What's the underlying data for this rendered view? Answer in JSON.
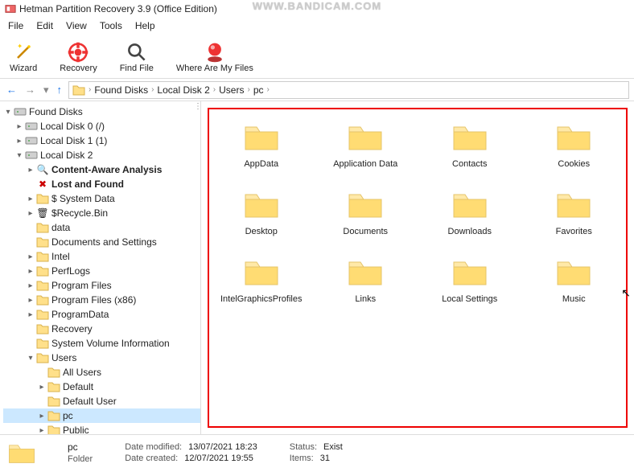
{
  "window": {
    "title": "Hetman Partition Recovery 3.9 (Office Edition)"
  },
  "watermark": "WWW.BANDICAM.COM",
  "menu": {
    "file": "File",
    "edit": "Edit",
    "view": "View",
    "tools": "Tools",
    "help": "Help"
  },
  "toolbar": {
    "wizard": "Wizard",
    "recovery": "Recovery",
    "findfile": "Find File",
    "wherefiles": "Where Are My Files"
  },
  "breadcrumb": {
    "seg0": "Found Disks",
    "seg1": "Local Disk 2",
    "seg2": "Users",
    "seg3": "pc"
  },
  "tree": {
    "root": "Found Disks",
    "disk0": "Local Disk 0 (/)",
    "disk1": "Local Disk 1 (1)",
    "disk2": "Local Disk 2",
    "content_analysis": "Content-Aware Analysis",
    "lost_found": "Lost and Found",
    "system_data": "$ System Data",
    "recycle": "$Recycle.Bin",
    "data": "data",
    "docsettings": "Documents and Settings",
    "intel": "Intel",
    "perflogs": "PerfLogs",
    "progfiles": "Program Files",
    "progfilesx86": "Program Files (x86)",
    "programdata": "ProgramData",
    "recovery": "Recovery",
    "svi": "System Volume Information",
    "users": "Users",
    "allusers": "All Users",
    "default": "Default",
    "defaultuser": "Default User",
    "pc": "pc",
    "public": "Public"
  },
  "folders": [
    "AppData",
    "Application Data",
    "Contacts",
    "Cookies",
    "Desktop",
    "Documents",
    "Downloads",
    "Favorites",
    "IntelGraphicsProfiles",
    "Links",
    "Local Settings",
    "Music"
  ],
  "status": {
    "name": "pc",
    "type": "Folder",
    "modified_lbl": "Date modified:",
    "modified": "13/07/2021 18:23",
    "created_lbl": "Date created:",
    "created": "12/07/2021 19:55",
    "status_lbl": "Status:",
    "status_val": "Exist",
    "items_lbl": "Items:",
    "items": "31"
  }
}
